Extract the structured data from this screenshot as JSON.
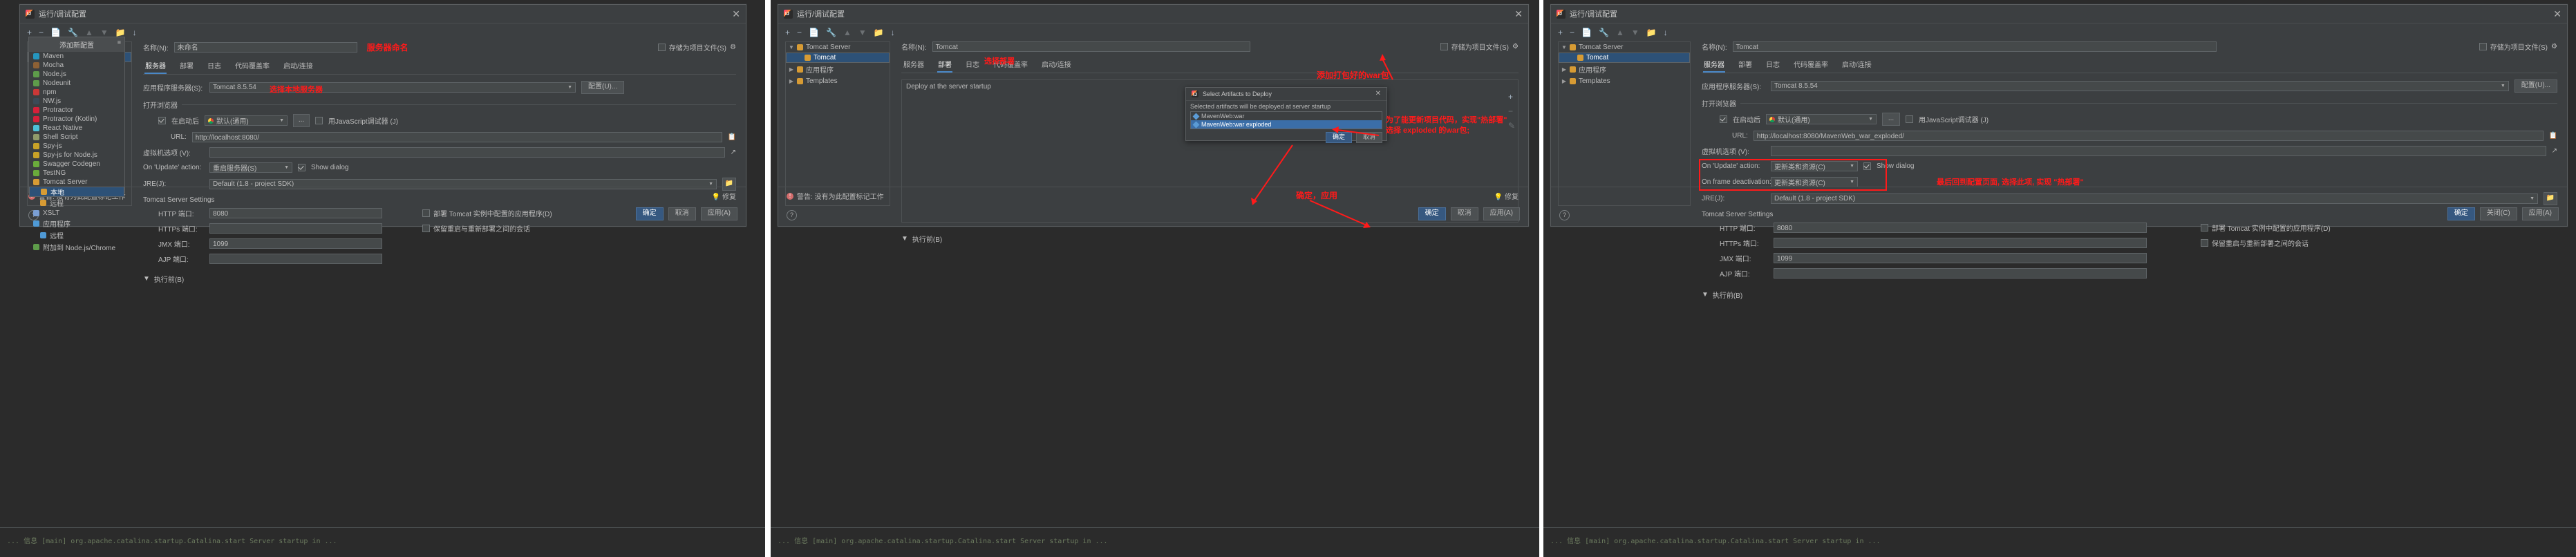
{
  "window": {
    "title": "运行/调试配置",
    "logo_icon": "intellij-logo-icon",
    "close_icon": "close-icon"
  },
  "toolbar": {
    "add_icon": "plus-icon",
    "remove_icon": "minus-icon",
    "copy_icon": "copy-icon",
    "edit_templates_icon": "wrench-icon",
    "move_up_icon": "chevron-up-icon",
    "move_down_icon": "chevron-down-icon",
    "folder_icon": "new-folder-icon",
    "sort_icon": "sort-alpha-icon"
  },
  "add_config_popup": {
    "header": "添加新配置",
    "pin_icon": "collapse-icon",
    "items": [
      {
        "label": "Maven",
        "icon": "maven-icon",
        "color": "#2596be"
      },
      {
        "label": "Mocha",
        "icon": "mocha-icon",
        "color": "#8d6135"
      },
      {
        "label": "Node.js",
        "icon": "nodejs-icon",
        "color": "#5e9c4a"
      },
      {
        "label": "Nodeunit",
        "icon": "nodeunit-icon",
        "color": "#5e9c4a"
      },
      {
        "label": "npm",
        "icon": "npm-icon",
        "color": "#cb3837"
      },
      {
        "label": "NW.js",
        "icon": "nwjs-icon",
        "color": "#3b4a57"
      },
      {
        "label": "Protractor",
        "icon": "protractor-icon",
        "color": "#d6203a"
      },
      {
        "label": "Protractor (Kotlin)",
        "icon": "protractor-kotlin-icon",
        "color": "#d6203a"
      },
      {
        "label": "React Native",
        "icon": "react-native-icon",
        "color": "#4cc0d8"
      },
      {
        "label": "Shell Script",
        "icon": "shell-script-icon",
        "color": "#8f9a6a"
      },
      {
        "label": "Spy-js",
        "icon": "spy-js-icon",
        "color": "#c9a227"
      },
      {
        "label": "Spy-js for Node.js",
        "icon": "spy-js-node-icon",
        "color": "#c9a227"
      },
      {
        "label": "Swagger Codegen",
        "icon": "swagger-icon",
        "color": "#6aab3b"
      },
      {
        "label": "TestNG",
        "icon": "testng-icon",
        "color": "#6aab3b"
      },
      {
        "label": "Tomcat Server",
        "icon": "tomcat-icon",
        "color": "#d79b34",
        "expanded": true
      },
      {
        "label": "本地",
        "icon": "local-icon",
        "color": "#d79b34",
        "indent": true,
        "selected": true
      },
      {
        "label": "远程",
        "icon": "remote-icon",
        "color": "#d79b34",
        "indent": true
      },
      {
        "label": "XSLT",
        "icon": "xslt-icon",
        "color": "#7b9fd4"
      },
      {
        "label": "应用程序",
        "icon": "application-icon",
        "color": "#4f9ad6"
      },
      {
        "label": "远程",
        "icon": "remote2-icon",
        "color": "#4f9ad6",
        "indent": true
      },
      {
        "label": "附加到 Node.js/Chrome",
        "icon": "attach-node-icon",
        "color": "#5e9c4a"
      }
    ]
  },
  "panel1": {
    "name_label": "名称(N):",
    "name_value": "未命名",
    "name_annotation": "服务器命名",
    "store_as_project_file": "存储为项目文件(S)",
    "gear_icon": "gear-icon",
    "tabs": [
      "服务器",
      "部署",
      "日志",
      "代码覆盖率",
      "启动/连接"
    ],
    "active_tab": "服务器",
    "app_server_label": "应用程序服务器(S):",
    "app_server_value": "Tomcat 8.5.54",
    "app_server_annotation": "选择本地服务器",
    "configure_button": "配置(U)...",
    "open_browser_section": "打开浏览器",
    "after_launch_label": "在启动后",
    "browser_value": "默认(通用)",
    "browser_icon": "chrome-icon",
    "ellipsis_button": "...",
    "js_debugger_label": "用JavaScript调试器 (J)",
    "url_label": "URL:",
    "url_value": "http://localhost:8080/",
    "copy_icon": "copy-url-icon",
    "vm_options_label": "虚拟机选项 (V):",
    "expand_icon": "expand-icon",
    "on_update_label": "On 'Update' action:",
    "on_update_value": "重启服务器(S)",
    "show_dialog_label": "Show dialog",
    "jre_label": "JRE(J):",
    "jre_value": "Default (1.8 - project SDK)",
    "jre_browse_icon": "browse-icon",
    "tomcat_settings_section": "Tomcat Server Settings",
    "http_port_label": "HTTP 端口:",
    "http_port_value": "8080",
    "https_port_label": "HTTPs 端口:",
    "https_port_value": "",
    "jmx_port_label": "JMX 端口:",
    "jmx_port_value": "1099",
    "ajp_port_label": "AJP 端口:",
    "ajp_port_value": "",
    "deploy_tomcat_label": "部署 Tomcat 实例中配置的应用程序(D)",
    "preserve_sessions_label": "保留重启与重新部署之间的会话",
    "before_launch_section": "执行前(B)",
    "warning_text": "警告: 没有为此配置标记工作",
    "fix_label": "修复",
    "buttons": {
      "ok": "确定",
      "cancel": "取消",
      "apply": "应用(A)"
    }
  },
  "panel2": {
    "name_label": "名称(N):",
    "name_value": "Tomcat",
    "store_as_project_file": "存储为项目文件(S)",
    "tree": [
      {
        "label": "Tomcat Server",
        "icon": "tomcat-icon",
        "expanded": true
      },
      {
        "label": "Tomcat",
        "icon": "tomcat-item-icon",
        "selected": true,
        "indent": true
      },
      {
        "label": "应用程序",
        "icon": "application-icon",
        "expanded": false
      },
      {
        "label": "Templates",
        "icon": "templates-icon",
        "expanded": false
      }
    ],
    "tabs": [
      "服务器",
      "部署",
      "日志",
      "代码覆盖率",
      "启动/连接"
    ],
    "active_tab": "部署",
    "tab_annotation": "选择部署",
    "deploy_header": "Deploy at the server startup",
    "add_icon": "plus-icon",
    "remove_icon": "minus-icon",
    "edit_icon": "pencil-icon",
    "add_war_annotation": "添加打包好的war包",
    "artifact_dialog": {
      "title": "Select Artifacts to Deploy",
      "close_icon": "close-icon",
      "subtitle": "Selected artifacts will be deployed at server startup",
      "items": [
        {
          "label": "MavenWeb:war",
          "icon": "artifact-icon",
          "selected": false
        },
        {
          "label": "MavenWeb:war exploded",
          "icon": "artifact-icon",
          "selected": true
        }
      ],
      "ok": "确定",
      "cancel": "取消"
    },
    "hot_deploy_annotation_line1": "为了能更新项目代码，实现\"热部署\"",
    "hot_deploy_annotation_line2": "选择 exploded 的war包;",
    "confirm_annotation": "确定，应用",
    "before_launch_section": "执行前(B)",
    "warning_text": "警告: 没有为此配置标记工作",
    "fix_label": "修复",
    "buttons": {
      "ok": "确定",
      "cancel": "取消",
      "apply": "应用(A)"
    }
  },
  "panel3": {
    "name_label": "名称(N):",
    "name_value": "Tomcat",
    "store_as_project_file": "存储为项目文件(S)",
    "tree": [
      {
        "label": "Tomcat Server",
        "icon": "tomcat-icon",
        "expanded": true
      },
      {
        "label": "Tomcat",
        "icon": "tomcat-item-icon",
        "selected": true,
        "indent": true
      },
      {
        "label": "应用程序",
        "icon": "application-icon",
        "expanded": false
      },
      {
        "label": "Templates",
        "icon": "templates-icon",
        "expanded": false
      }
    ],
    "tabs": [
      "服务器",
      "部署",
      "日志",
      "代码覆盖率",
      "启动/连接"
    ],
    "active_tab": "服务器",
    "app_server_label": "应用程序服务器(S):",
    "app_server_value": "Tomcat 8.5.54",
    "configure_button": "配置(U)...",
    "open_browser_section": "打开浏览器",
    "after_launch_label": "在启动后",
    "browser_value": "默认(通用)",
    "browser_icon": "chrome-icon",
    "ellipsis_button": "...",
    "js_debugger_label": "用JavaScript调试器 (J)",
    "url_label": "URL:",
    "url_value": "http://localhost:8080/MavenWeb_war_exploded/",
    "copy_icon": "copy-url-icon",
    "vm_options_label": "虚拟机选项 (V):",
    "on_update_label": "On 'Update' action:",
    "on_update_value": "更新类和资源(C)",
    "on_frame_label": "On frame deactivation:",
    "on_frame_value": "更新类和资源(C)",
    "show_dialog_label": "Show dialog",
    "update_annotation": "最后回到配置页面, 选择此项, 实现 \"热部署\"",
    "jre_label": "JRE(J):",
    "jre_value": "Default (1.8 - project SDK)",
    "tomcat_settings_section": "Tomcat Server Settings",
    "http_port_label": "HTTP 端口:",
    "http_port_value": "8080",
    "https_port_label": "HTTPs 端口:",
    "https_port_value": "",
    "jmx_port_label": "JMX 端口:",
    "jmx_port_value": "1099",
    "ajp_port_label": "AJP 端口:",
    "ajp_port_value": "",
    "deploy_tomcat_label": "部署 Tomcat 实例中配置的应用程序(D)",
    "preserve_sessions_label": "保留重启与重新部署之间的会话",
    "before_launch_section": "执行前(B)",
    "buttons": {
      "ok": "确定",
      "cancel": "关闭(C)",
      "apply": "应用(A)"
    }
  },
  "background_code": "... 信息 [main] org.apache.catalina.startup.Catalina.start Server startup in ..."
}
